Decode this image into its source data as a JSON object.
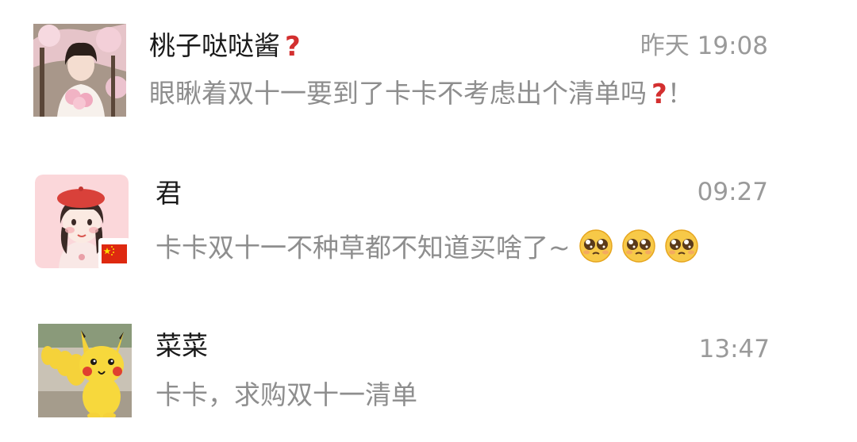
{
  "conversations": [
    {
      "name": "桃子哒哒酱",
      "name_badge": "?",
      "time": "昨天 19:08",
      "preview": "眼瞅着双十一要到了卡卡不考虑出个清单吗",
      "preview_suffix_mark": "?",
      "preview_tail": "！",
      "avatar": "cherry-blossom-girl-photo"
    },
    {
      "name": "君",
      "time": "09:27",
      "preview": "卡卡双十一不种草都不知道买啥了~",
      "emoji": [
        "pleading-face-emoji",
        "pleading-face-emoji",
        "pleading-face-emoji"
      ],
      "avatar": "cartoon-girl-red-beret",
      "avatar_badge": "china-flag-icon"
    },
    {
      "name": "菜菜",
      "time": "13:47",
      "preview": "卡卡，求购双十一清单",
      "avatar": "pikachu-parade-photo"
    }
  ],
  "colors": {
    "name": "#1a1a1a",
    "time": "#9a9a9a",
    "preview": "#8e8e8e",
    "question_mark": "#d32f2f"
  }
}
